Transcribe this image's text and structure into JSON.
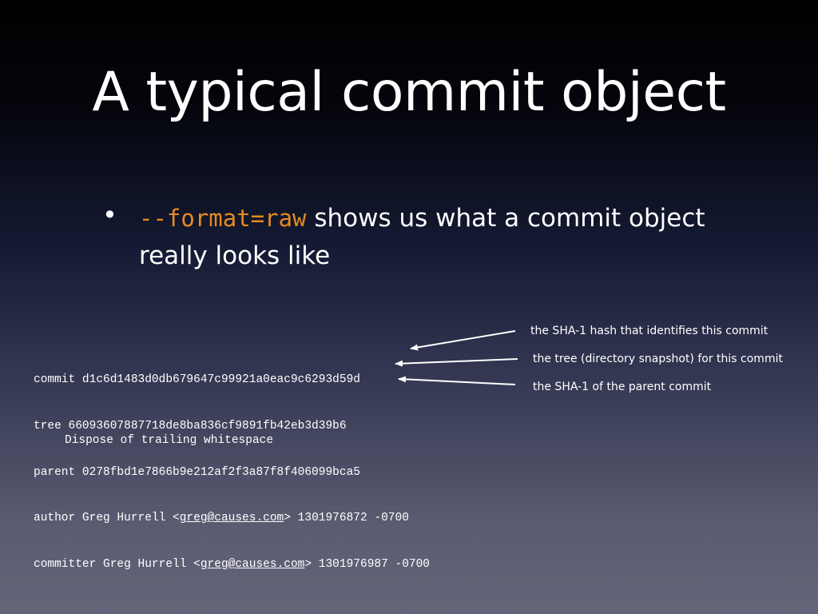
{
  "slide": {
    "title": "A typical commit object",
    "bullet": {
      "code": "--format=raw",
      "text": " shows us what a commit object really looks like"
    }
  },
  "commit": {
    "commit_line": "commit d1c6d1483d0db679647c99921a0eac9c6293d59d",
    "tree_line": "tree 66093607887718de8ba836cf9891fb42eb3d39b6",
    "parent_line": "parent 0278fbd1e7866b9e212af2f3a87f8f406099bca5",
    "author_prefix": "author Greg Hurrell <",
    "author_email": "greg@causes.com",
    "author_suffix": "> 1301976872 -0700",
    "committer_prefix": "committer Greg Hurrell <",
    "committer_email": "greg@causes.com",
    "committer_suffix": "> 1301976987 -0700",
    "message": "Dispose of trailing whitespace"
  },
  "annotations": {
    "sha": "the SHA-1 hash that identifies this commit",
    "tree": "the tree (directory snapshot) for this commit",
    "parent": "the SHA-1 of the parent commit"
  }
}
